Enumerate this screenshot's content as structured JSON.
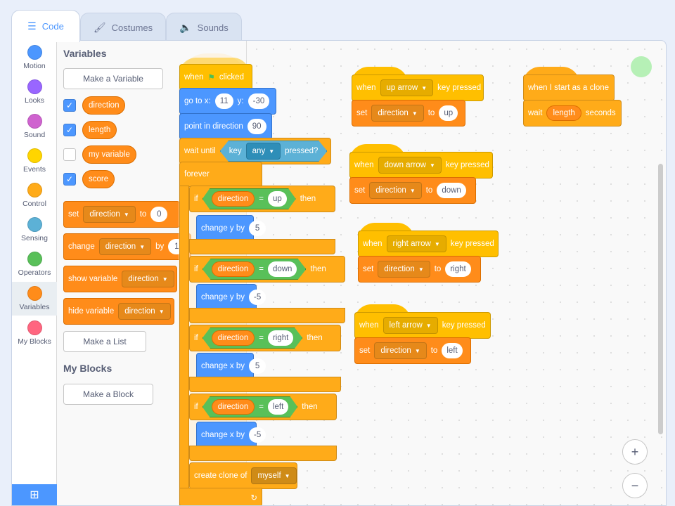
{
  "tabs": [
    {
      "label": "Code",
      "icon": "code-icon",
      "active": true
    },
    {
      "label": "Costumes",
      "icon": "brush-icon",
      "active": false
    },
    {
      "label": "Sounds",
      "icon": "speaker-icon",
      "active": false
    }
  ],
  "categories": [
    {
      "label": "Motion",
      "color": "#4c97ff"
    },
    {
      "label": "Looks",
      "color": "#9966ff"
    },
    {
      "label": "Sound",
      "color": "#cf63cf"
    },
    {
      "label": "Events",
      "color": "#ffd500"
    },
    {
      "label": "Control",
      "color": "#ffab19"
    },
    {
      "label": "Sensing",
      "color": "#5cb1d6"
    },
    {
      "label": "Operators",
      "color": "#59c059"
    },
    {
      "label": "Variables",
      "color": "#ff8c1a",
      "active": true
    },
    {
      "label": "My Blocks",
      "color": "#ff6680"
    }
  ],
  "palette": {
    "variables_title": "Variables",
    "make_variable": "Make a Variable",
    "vars": [
      {
        "name": "direction",
        "checked": true
      },
      {
        "name": "length",
        "checked": true
      },
      {
        "name": "my variable",
        "checked": false
      },
      {
        "name": "score",
        "checked": true
      }
    ],
    "set_block": {
      "set": "set",
      "var": "direction",
      "to": "to",
      "val": "0"
    },
    "change_block": {
      "change": "change",
      "var": "direction",
      "by": "by",
      "val": "1"
    },
    "show_block": {
      "label": "show variable",
      "var": "direction"
    },
    "hide_block": {
      "label": "hide variable",
      "var": "direction"
    },
    "make_list": "Make a List",
    "myblocks_title": "My Blocks",
    "make_block": "Make a Block"
  },
  "script_main": {
    "when_flag": "when",
    "clicked": "clicked",
    "goto": "go to x:",
    "goto_x": "11",
    "goto_y_label": "y:",
    "goto_y": "-30",
    "point": "point in direction",
    "point_val": "90",
    "wait_until": "wait until",
    "key": "key",
    "key_opt": "any",
    "pressed": "pressed?",
    "forever": "forever",
    "ifs": [
      {
        "if": "if",
        "var": "direction",
        "eq": "=",
        "val": "up",
        "then": "then",
        "act": "change y by",
        "act_val": "5"
      },
      {
        "if": "if",
        "var": "direction",
        "eq": "=",
        "val": "down",
        "then": "then",
        "act": "change y by",
        "act_val": "-5"
      },
      {
        "if": "if",
        "var": "direction",
        "eq": "=",
        "val": "right",
        "then": "then",
        "act": "change x by",
        "act_val": "5"
      },
      {
        "if": "if",
        "var": "direction",
        "eq": "=",
        "val": "left",
        "then": "then",
        "act": "change x by",
        "act_val": "-5"
      }
    ],
    "create_clone": "create clone of",
    "clone_opt": "myself"
  },
  "key_scripts": [
    {
      "when": "when",
      "key": "up arrow",
      "kp": "key pressed",
      "set": "set",
      "var": "direction",
      "to": "to",
      "val": "up"
    },
    {
      "when": "when",
      "key": "down arrow",
      "kp": "key pressed",
      "set": "set",
      "var": "direction",
      "to": "to",
      "val": "down"
    },
    {
      "when": "when",
      "key": "right arrow",
      "kp": "key pressed",
      "set": "set",
      "var": "direction",
      "to": "to",
      "val": "right"
    },
    {
      "when": "when",
      "key": "left arrow",
      "kp": "key pressed",
      "set": "set",
      "var": "direction",
      "to": "to",
      "val": "left"
    }
  ],
  "clone_script": {
    "when": "when I start as a clone",
    "wait": "wait",
    "var": "length",
    "seconds": "seconds"
  },
  "zoom": {
    "in": "+",
    "out": "−"
  }
}
